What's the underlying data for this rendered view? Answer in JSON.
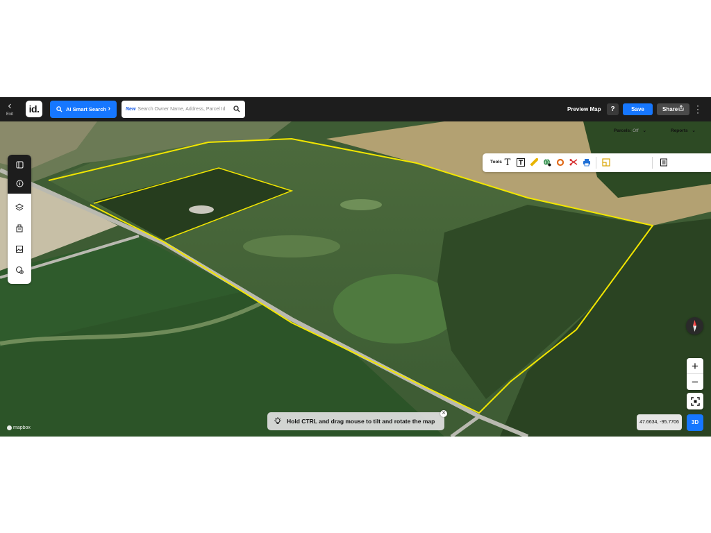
{
  "topbar": {
    "exit_label": "Exit",
    "logo_text": "id.",
    "ai_search_label": "AI Smart Search",
    "search_badge": "New",
    "search_placeholder": "Search Owner Name, Address, Parcel Id",
    "preview_label": "Preview Map",
    "help_label": "?",
    "save_label": "Save",
    "share_label": "Share"
  },
  "left_toolbar": {
    "items": [
      "panel-toggle-icon",
      "info-icon",
      "layers-icon",
      "buildings-icon",
      "image-icon",
      "add-location-icon"
    ]
  },
  "tools_panel": {
    "label": "Tools",
    "tools": [
      "text-icon",
      "text-box-icon",
      "ruler-icon",
      "globe-add-icon",
      "ring-icon",
      "scissors-icon",
      "print-icon"
    ],
    "parcels_label": "Parcels:",
    "parcels_state": "Off",
    "reports_label": "Reports"
  },
  "map": {
    "hint_text": "Hold CTRL and drag mouse to tilt and rotate the map",
    "coordinates": "47.6634, -95.7706",
    "mode_button": "3D",
    "zoom_in": "+",
    "zoom_out": "−",
    "attribution": "mapbox",
    "boundary_color": "#f2e600"
  }
}
